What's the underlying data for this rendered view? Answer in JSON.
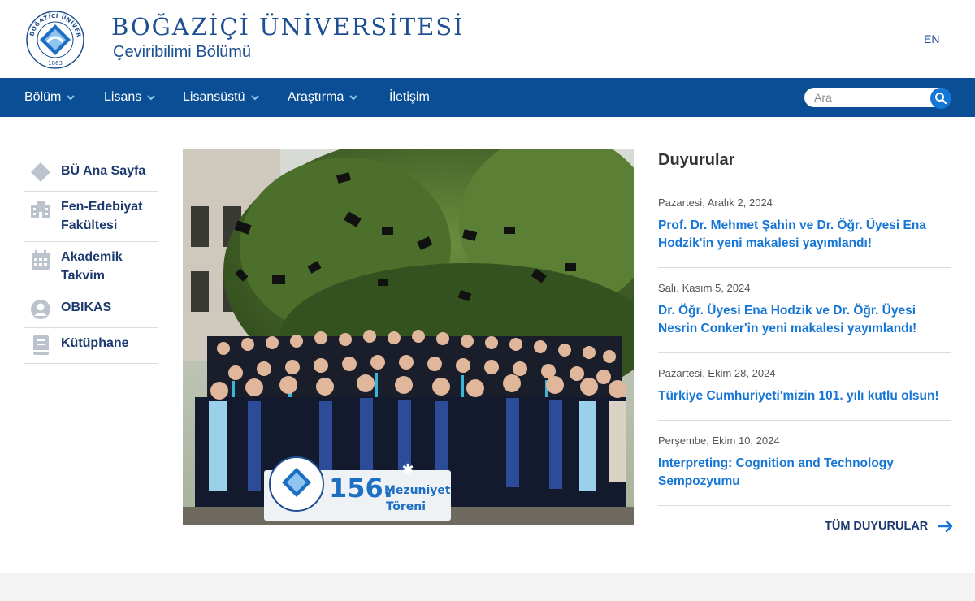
{
  "header": {
    "university": "BOĞAZİÇİ ÜNİVERSİTESİ",
    "department": "Çeviribilimi Bölümü",
    "lang": "EN",
    "logo": {
      "ring_text": "BOĞAZİÇİ ÜNİVERSİTESİ",
      "year": "1863"
    }
  },
  "nav": {
    "items": [
      {
        "label": "Bölüm",
        "has_dropdown": true
      },
      {
        "label": "Lisans",
        "has_dropdown": true
      },
      {
        "label": "Lisansüstü",
        "has_dropdown": true
      },
      {
        "label": "Araştırma",
        "has_dropdown": true
      },
      {
        "label": "İletişim",
        "has_dropdown": false
      }
    ],
    "search_placeholder": "Ara"
  },
  "sidebar": {
    "items": [
      {
        "label": "BÜ Ana Sayfa",
        "icon": "diamond-icon"
      },
      {
        "label": "Fen-Edebiyat Fakültesi",
        "icon": "building-icon"
      },
      {
        "label": "Akademik Takvim",
        "icon": "calendar-icon"
      },
      {
        "label": "OBIKAS",
        "icon": "user-circle-icon"
      },
      {
        "label": "Kütüphane",
        "icon": "book-icon"
      }
    ]
  },
  "hero": {
    "banner_number": "156.",
    "banner_text_1": "Mezuniyet",
    "banner_text_2": "Töreni"
  },
  "announcements": {
    "title": "Duyurular",
    "items": [
      {
        "date": "Pazartesi, Aralık 2, 2024",
        "title": "Prof. Dr. Mehmet Şahin ve Dr. Öğr. Üyesi Ena Hodzik'in yeni makalesi yayımlandı!"
      },
      {
        "date": "Salı, Kasım 5, 2024",
        "title": "Dr. Öğr. Üyesi Ena Hodzik ve Dr. Öğr. Üyesi Nesrin Conker'in yeni makalesi yayımlandı!"
      },
      {
        "date": "Pazartesi, Ekim 28, 2024",
        "title": "Türkiye Cumhuriyeti'mizin 101. yılı kutlu olsun!"
      },
      {
        "date": "Perşembe, Ekim 10, 2024",
        "title": "Interpreting: Cognition and Technology Sempozyumu"
      }
    ],
    "all_label": "TÜM DUYURULAR"
  },
  "colors": {
    "brand_blue": "#0a4f96",
    "link_blue": "#1676d6",
    "dark_navy": "#1d3a6e",
    "icon_gray": "#bcc3cc"
  }
}
